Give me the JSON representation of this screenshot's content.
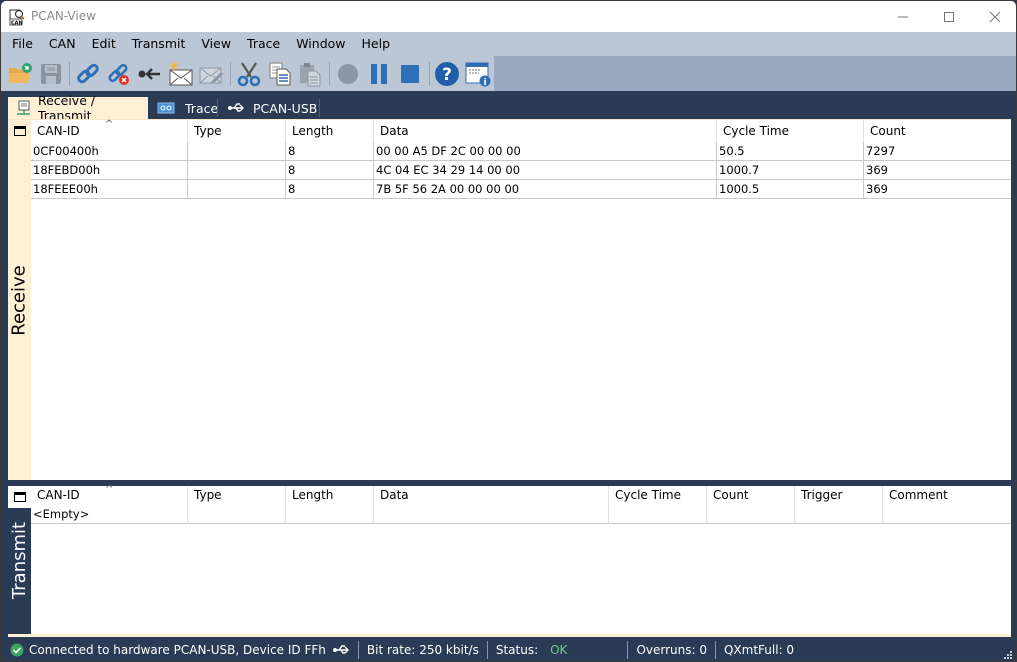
{
  "window": {
    "title": "PCAN-View"
  },
  "menu": {
    "items": [
      "File",
      "CAN",
      "Edit",
      "Transmit",
      "View",
      "Trace",
      "Window",
      "Help"
    ]
  },
  "toolbar": {
    "buttons": [
      {
        "name": "open-icon",
        "tooltip": "Open"
      },
      {
        "name": "save-icon",
        "tooltip": "Save"
      },
      {
        "name": "connect-icon",
        "tooltip": "Connect"
      },
      {
        "name": "disconnect-icon",
        "tooltip": "Disconnect"
      },
      {
        "name": "reset-icon",
        "tooltip": "Reset"
      },
      {
        "name": "new-message-icon",
        "tooltip": "New Message"
      },
      {
        "name": "edit-message-icon",
        "tooltip": "Edit Message"
      },
      {
        "name": "cut-icon",
        "tooltip": "Cut"
      },
      {
        "name": "copy-icon",
        "tooltip": "Copy"
      },
      {
        "name": "paste-icon",
        "tooltip": "Paste"
      },
      {
        "name": "record-icon",
        "tooltip": "Record"
      },
      {
        "name": "pause-icon",
        "tooltip": "Pause"
      },
      {
        "name": "stop-icon",
        "tooltip": "Stop"
      },
      {
        "name": "help-icon",
        "tooltip": "Help"
      },
      {
        "name": "about-icon",
        "tooltip": "About"
      }
    ]
  },
  "tabs": [
    {
      "label": "Receive / Transmit",
      "active": true
    },
    {
      "label": "Trace",
      "active": false
    },
    {
      "label": "PCAN-USB",
      "active": false
    }
  ],
  "receive": {
    "side_label": "Receive",
    "columns": [
      "CAN-ID",
      "Type",
      "Length",
      "Data",
      "Cycle Time",
      "Count"
    ],
    "rows": [
      {
        "can_id": "0CF00400h",
        "type": "",
        "length": "8",
        "data": "00 00 A5 DF 2C 00 00 00",
        "cycle_time": "50.5",
        "count": "7297"
      },
      {
        "can_id": "18FEBD00h",
        "type": "",
        "length": "8",
        "data": "4C 04 EC 34 29 14 00 00",
        "cycle_time": "1000.7",
        "count": "369"
      },
      {
        "can_id": "18FEEE00h",
        "type": "",
        "length": "8",
        "data": "7B 5F 56 2A 00 00 00 00",
        "cycle_time": "1000.5",
        "count": "369"
      }
    ]
  },
  "transmit": {
    "side_label": "Transmit",
    "columns": [
      "CAN-ID",
      "Type",
      "Length",
      "Data",
      "Cycle Time",
      "Count",
      "Trigger",
      "Comment"
    ],
    "rows": [
      {
        "can_id": "<Empty>",
        "type": "",
        "length": "",
        "data": "",
        "cycle_time": "",
        "count": "",
        "trigger": "",
        "comment": ""
      }
    ]
  },
  "status": {
    "connection": "Connected to hardware PCAN-USB, Device ID FFh",
    "bit_rate": "Bit rate: 250 kbit/s",
    "status_label": "Status:",
    "status_value": "OK",
    "overruns": "Overruns: 0",
    "qxmtfull": "QXmtFull: 0"
  },
  "colors": {
    "frame": "#2b3a55",
    "accent_tab": "#fdf0d5",
    "toolbar": "#bcc7d6",
    "status_ok": "#6fcf7f"
  }
}
